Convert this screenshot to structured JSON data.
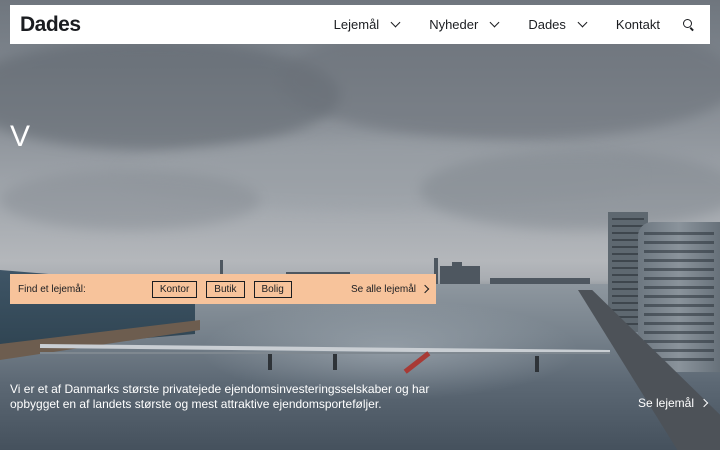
{
  "nav": {
    "logo": "Dades",
    "items": [
      {
        "label": "Lejemål",
        "has_dropdown": true
      },
      {
        "label": "Nyheder",
        "has_dropdown": true
      },
      {
        "label": "Dades",
        "has_dropdown": true
      },
      {
        "label": "Kontakt",
        "has_dropdown": false
      }
    ],
    "search_icon": "search-icon"
  },
  "hero": {
    "heading": "V"
  },
  "finder": {
    "label": "Find et lejemål:",
    "options": [
      "Kontor",
      "Butik",
      "Bolig"
    ],
    "see_all": "Se alle lejemål",
    "background": "#f7c39b"
  },
  "intro": {
    "text": "Vi er et af Danmarks største privatejede ejendomsinvesteringsselskaber og har opbygget en af landets største og mest attraktive ejendomsporteføljer.",
    "link": "Se lejemål"
  }
}
